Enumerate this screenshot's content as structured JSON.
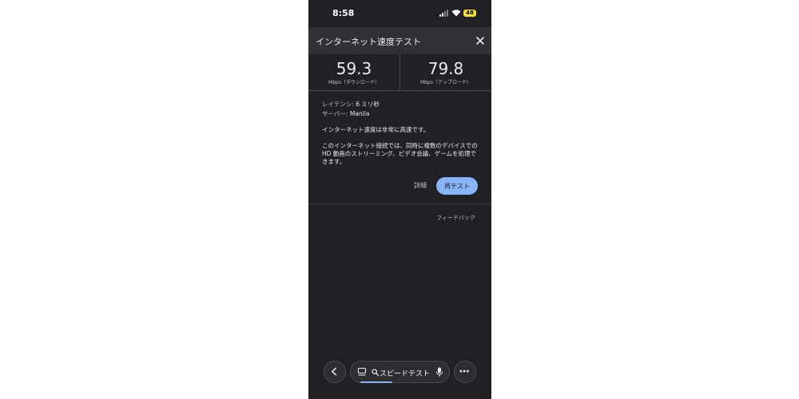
{
  "status_bar": {
    "time": "8:58",
    "battery": "48"
  },
  "header": {
    "title": "インターネット速度テスト"
  },
  "speeds": {
    "download": {
      "value": "59.3",
      "unit": "Mbps（ダウンロード）"
    },
    "upload": {
      "value": "79.8",
      "unit": "Mbps（アップロード）"
    }
  },
  "info": {
    "latency_label": "レイテンシ:",
    "latency_value": "6 ミリ秒",
    "server_label": "サーバー:",
    "server_value": "Manila",
    "summary": "インターネット速度は非常に高速です。",
    "description": "このインターネット接続では、同時に複数のデバイスでの HD 動画のストリーミング、ビデオ会議、ゲームを処理できます。"
  },
  "actions": {
    "details_label": "詳細",
    "retest_label": "再テスト"
  },
  "feedback_label": "フィードバック",
  "bottom_bar": {
    "search_text": "スピードテスト"
  },
  "colors": {
    "background": "#202124",
    "header": "#303134",
    "accent": "#8ab4f8"
  },
  "icons": [
    "close-icon",
    "back-icon",
    "tabs-icon",
    "search-icon",
    "mic-icon",
    "more-icon",
    "signal-icon",
    "wifi-icon",
    "battery-icon"
  ]
}
